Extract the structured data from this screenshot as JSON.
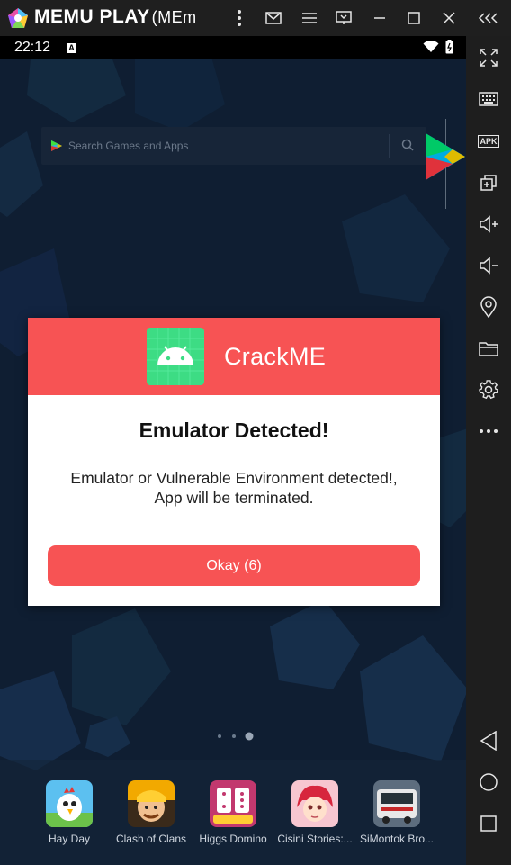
{
  "titlebar": {
    "app_name": "MEMU PLAY",
    "window_label": "(MEm"
  },
  "statusbar": {
    "time": "22:12",
    "badge": "A"
  },
  "search": {
    "placeholder": "Search Games and Apps"
  },
  "dialog": {
    "app_name": "CrackME",
    "title": "Emulator Detected!",
    "message_line1": "Emulator or Vulnerable Environment detected!,",
    "message_line2": "App will be terminated.",
    "button_label": "Okay (6)",
    "accent_color": "#f75354"
  },
  "dock": {
    "apps": [
      {
        "label": "Hay Day"
      },
      {
        "label": "Clash of Clans"
      },
      {
        "label": "Higgs Domino"
      },
      {
        "label": "Cisini Stories:..."
      },
      {
        "label": "SiMontok Bro..."
      }
    ]
  },
  "sidebar": {
    "apk_label": "APK",
    "icons": [
      "fullscreen-icon",
      "keyboard-icon",
      "apk-install-icon",
      "multi-window-icon",
      "volume-up-icon",
      "volume-down-icon",
      "location-icon",
      "folder-icon",
      "settings-icon",
      "more-icon",
      "back-icon",
      "home-icon",
      "recents-icon"
    ]
  },
  "titlebar_icons": [
    "kebab-menu-icon",
    "mail-icon",
    "hamburger-menu-icon",
    "screen-icon",
    "minimize-icon",
    "maximize-icon",
    "close-icon",
    "collapse-icon"
  ]
}
